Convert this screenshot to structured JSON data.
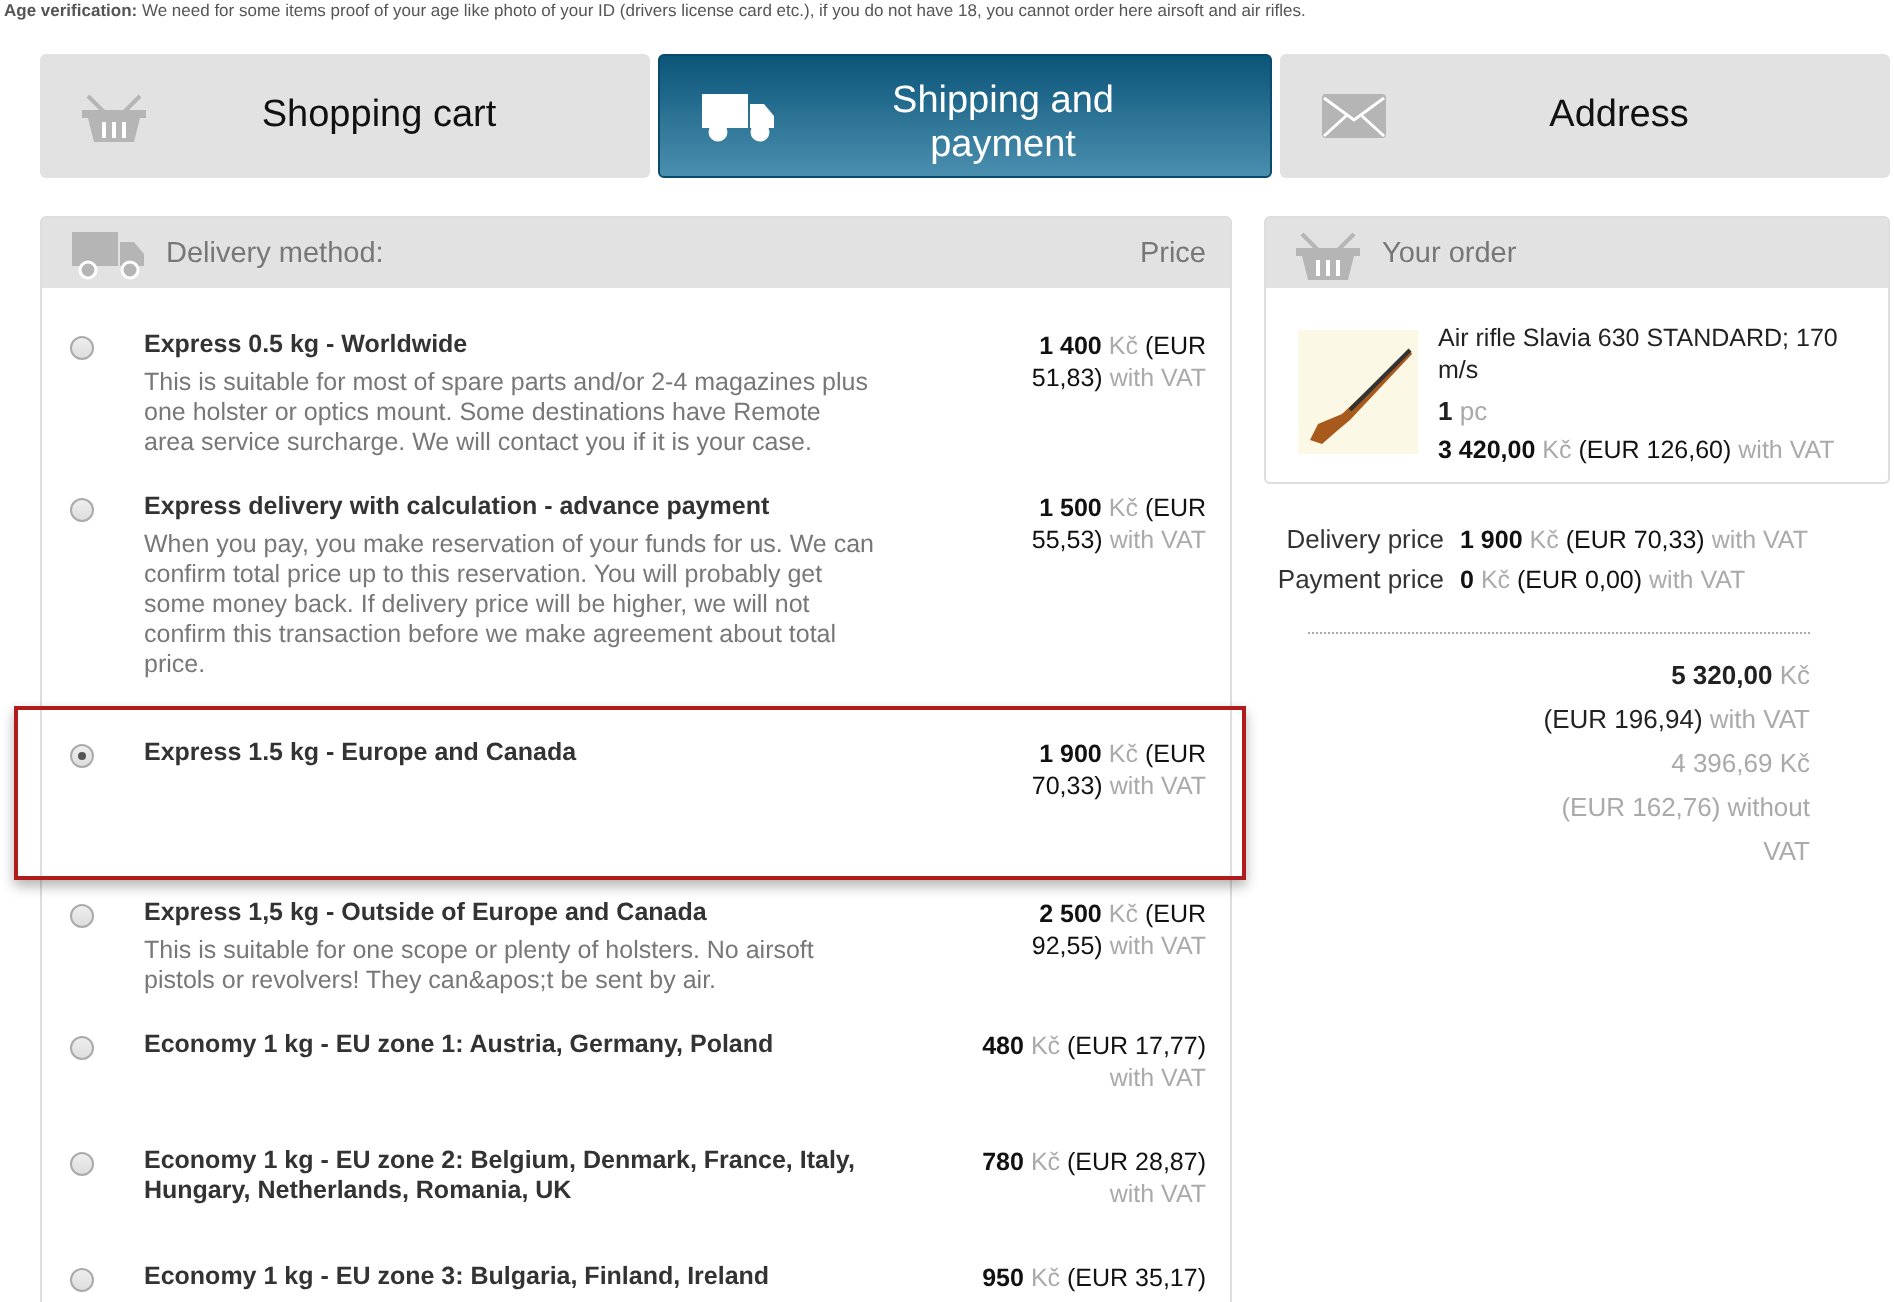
{
  "notice": "**Age verification:** We need for some items proof of your age like photo of your ID (drivers license card etc.), if you do not have 18, you cannot order here airsoft and air rifles.",
  "steps": [
    {
      "label": "Shopping cart",
      "selected": false
    },
    {
      "label": "Shipping and payment",
      "selected": true
    },
    {
      "label": "Address",
      "selected": false
    }
  ],
  "delivery": {
    "title": "Delivery method:",
    "price_heading": "Price",
    "options": [
      {
        "name": "Express 0.5 kg - Worldwide",
        "description": "This is suitable for most of spare parts and/or 2-4 magazines plus one holster or optics mount. Some destinations have Remote area service surcharge. We will contact you if it is your case.",
        "amount": "1 400",
        "currency": "Kč",
        "eur": "(EUR 51,83)",
        "vat": "with VAT",
        "selected": false
      },
      {
        "name": "Express delivery with calculation - advance payment",
        "description": "When you pay, you make reservation of your funds for us. We can confirm total price up to this reservation. You will probably get some money back. If delivery price will be higher, we will not confirm this transaction before we make agreement about total price.",
        "amount": "1 500",
        "currency": "Kč",
        "eur": "(EUR 55,53)",
        "vat": "with VAT",
        "selected": false
      },
      {
        "name": "Express 1.5 kg - Europe and Canada",
        "amount": "1 900",
        "currency": "Kč",
        "eur": "(EUR 70,33)",
        "vat": "with VAT",
        "selected": true
      },
      {
        "name": "Express 1,5 kg - Outside of Europe and Canada",
        "description": "This is suitable for one scope or plenty of holsters. No airsoft pistols or revolvers! They can&apos;t be sent by air.",
        "amount": "2 500",
        "currency": "Kč",
        "eur": "(EUR 92,55)",
        "vat": "with VAT",
        "selected": false
      },
      {
        "name": "Economy 1 kg - EU zone 1: Austria, Germany, Poland",
        "amount": "480",
        "currency": "Kč",
        "eur": "(EUR 17,77)",
        "vat": "with VAT",
        "selected": false
      },
      {
        "name": "Economy 1 kg - EU zone 2: Belgium, Denmark, France, Italy, Hungary, Netherlands, Romania, UK",
        "amount": "780",
        "currency": "Kč",
        "eur": "(EUR 28,87)",
        "vat": "with VAT",
        "selected": false
      },
      {
        "name": "Economy 1 kg - EU zone 3: Bulgaria, Finland, Ireland",
        "amount": "950",
        "currency": "Kč",
        "eur": "(EUR 35,17)",
        "selected": false
      }
    ]
  },
  "order": {
    "title": "Your order",
    "item": {
      "name": "Air rifle Slavia 630 STANDARD; 170 m/s",
      "quantity": "1",
      "unit": "pc",
      "amount": "3 420,00",
      "currency": "Kč",
      "eur": "(EUR 126,60)",
      "vat": "with VAT"
    },
    "fees": [
      {
        "label": "Delivery price",
        "amount": "1 900",
        "currency": "Kč",
        "eur": "(EUR 70,33)",
        "vat": "with VAT"
      },
      {
        "label": "Payment price",
        "amount": "0",
        "currency": "Kč",
        "eur": "(EUR 0,00)",
        "vat": "with VAT"
      }
    ],
    "total": {
      "amount": "5 320,00",
      "currency": "Kč",
      "eur": "(EUR 196,94)",
      "vat": "with VAT",
      "net": "4 396,69 Kč",
      "net_eur": "(EUR 162,76) without",
      "net_vat": "VAT"
    }
  }
}
